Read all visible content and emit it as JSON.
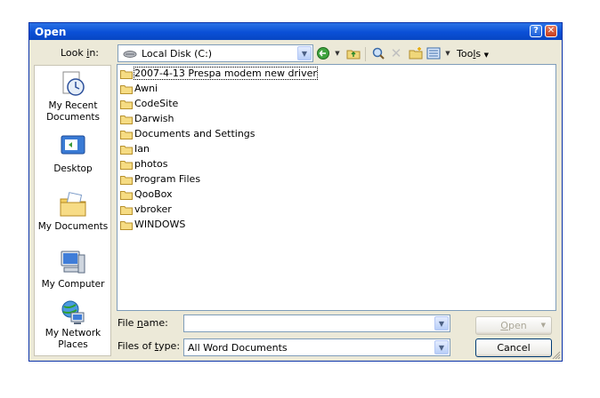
{
  "window": {
    "title": "Open"
  },
  "titlebar_buttons": {
    "help": "?",
    "close": "✕"
  },
  "lookin": {
    "label_pre": "Look ",
    "label_u": "i",
    "label_post": "n:",
    "value": "Local Disk (C:)"
  },
  "toolbar": {
    "tools_pre": "Too",
    "tools_u": "l",
    "tools_post": "s"
  },
  "places": [
    {
      "label_line1": "My Recent",
      "label_line2": "Documents",
      "icon": "recent-documents-icon"
    },
    {
      "label_line1": "Desktop",
      "label_line2": "",
      "icon": "desktop-icon"
    },
    {
      "label_line1": "My Documents",
      "label_line2": "",
      "icon": "my-documents-icon"
    },
    {
      "label_line1": "My Computer",
      "label_line2": "",
      "icon": "my-computer-icon"
    },
    {
      "label_line1": "My Network",
      "label_line2": "Places",
      "icon": "network-places-icon"
    }
  ],
  "files": [
    "2007-4-13 Prespa modem new driver",
    "Awni",
    "CodeSite",
    "Darwish",
    "Documents and Settings",
    "Ian",
    "photos",
    "Program Files",
    "QooBox",
    "vbroker",
    "WINDOWS"
  ],
  "filename": {
    "label_pre": "File ",
    "label_u": "n",
    "label_post": "ame:",
    "value": ""
  },
  "filetype": {
    "label_pre": "Files of ",
    "label_u": "t",
    "label_post": "ype:",
    "value": "All Word Documents"
  },
  "buttons": {
    "open_u": "O",
    "open_post": "pen",
    "cancel": "Cancel"
  },
  "colors": {
    "titlebar": "#0a4fd6",
    "dialog_bg": "#ece9d8",
    "folder": "#f0d77a"
  }
}
